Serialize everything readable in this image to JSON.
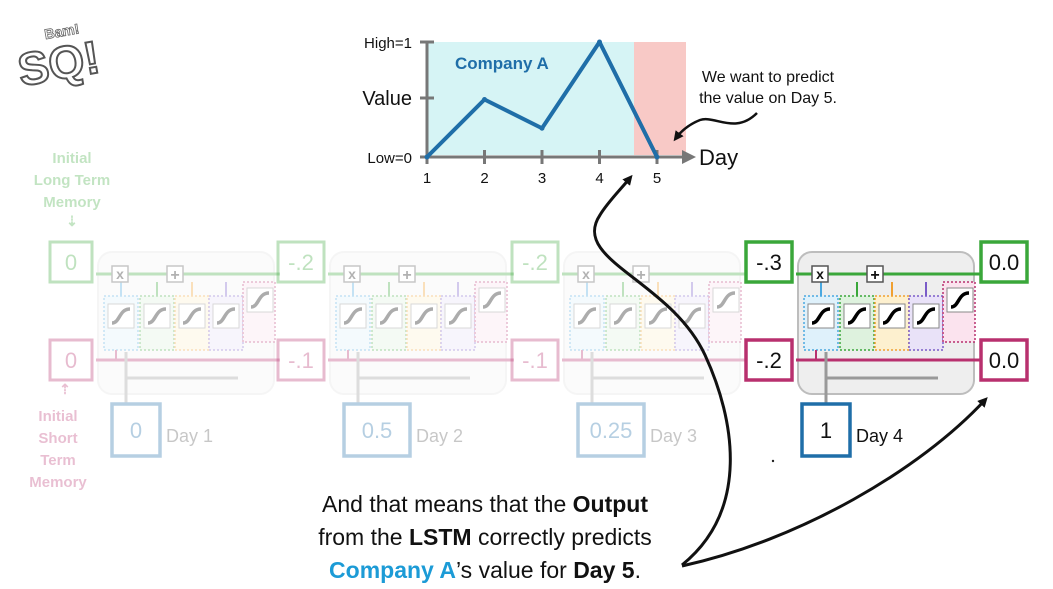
{
  "logo": {
    "text": "StatQuest",
    "sub": "Bam!"
  },
  "colors": {
    "long_term": "#3aa73a",
    "short_term": "#b8306e",
    "input": "#1f6ea8",
    "chart_fill_a": "#d6f4f5",
    "chart_fill_b": "#f8c9c6",
    "chart_line": "#1f6ea8",
    "highlight_text": "#1c9bd6"
  },
  "chart": {
    "y_high_label": "High=1",
    "y_mid_label": "Value",
    "y_low_label": "Low=0",
    "x_axis_label": "Day",
    "series_name": "Company A",
    "x_ticks": [
      "1",
      "2",
      "3",
      "4",
      "5"
    ],
    "note_line1": "We want to predict",
    "note_line2": "the value on Day 5."
  },
  "chart_data": {
    "type": "line",
    "x": [
      1,
      2,
      3,
      4,
      5
    ],
    "series": [
      {
        "name": "Company A",
        "values": [
          0.0,
          0.5,
          0.25,
          1.0,
          0.0
        ]
      }
    ],
    "ylim": [
      0,
      1
    ]
  },
  "labels": {
    "initial_long": [
      "Initial",
      "Long Term",
      "Memory"
    ],
    "initial_short": [
      "Initial",
      "Short",
      "Term",
      "Memory"
    ],
    "multiply_symbol": "x",
    "add_symbol": "+"
  },
  "long_term_values": [
    "0",
    "-.2",
    "-.2",
    "-.3",
    "0.0"
  ],
  "short_term_values": [
    "0",
    "-.1",
    "-.1",
    "-.2",
    "0.0"
  ],
  "inputs": [
    {
      "value": "0",
      "day": "Day 1"
    },
    {
      "value": "0.5",
      "day": "Day 2"
    },
    {
      "value": "0.25",
      "day": "Day 3"
    },
    {
      "value": "1",
      "day": "Day 4"
    }
  ],
  "caption": {
    "l1a": "And that means that the ",
    "l1b": "Output",
    "l2a": "from the ",
    "l2b": "LSTM",
    "l2c": " correctly predicts",
    "l3a": "Company A",
    "l3b": "’s value for ",
    "l3c": "Day 5",
    "l3d": "."
  }
}
